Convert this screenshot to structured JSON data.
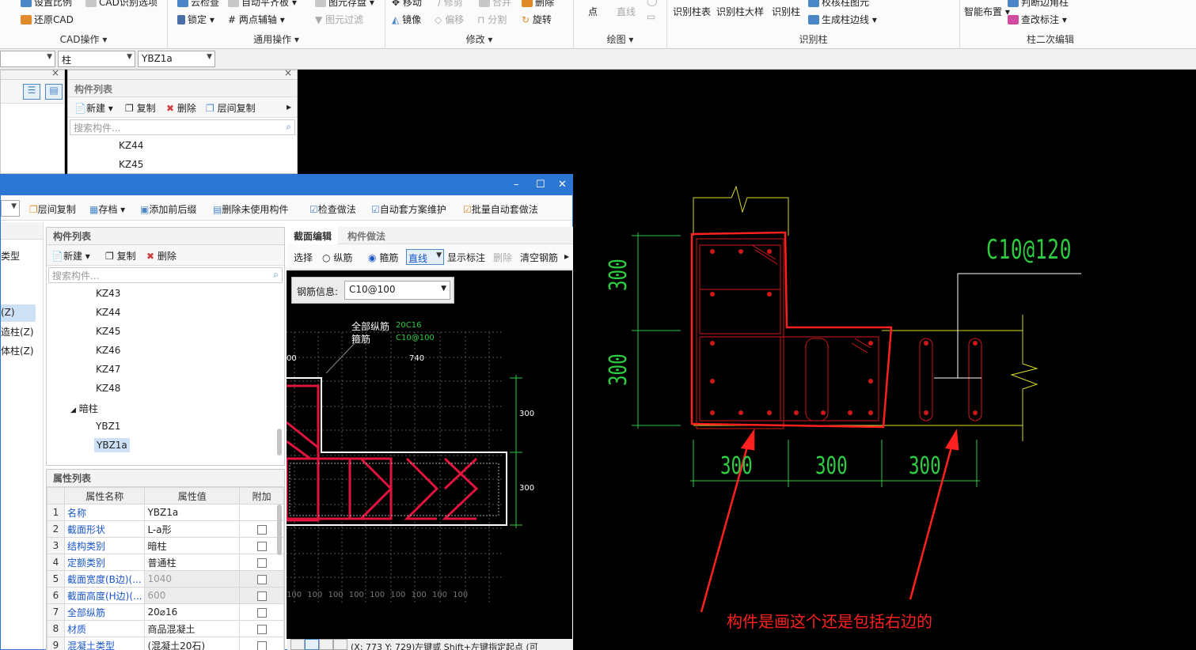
{
  "ribbon": {
    "cad_ops": {
      "items": [
        "设置比例",
        "CAD识别选项",
        "还原CAD"
      ],
      "title": "CAD操作"
    },
    "common_ops": {
      "items": [
        "云检查",
        "自动平齐板",
        "图元存盘",
        "锁定",
        "两点辅轴",
        "图元过滤"
      ],
      "title": "通用操作"
    },
    "modify": {
      "items": [
        "移动",
        "修剪",
        "合并",
        "删除",
        "镜像",
        "偏移",
        "分割",
        "旋转"
      ],
      "title": "修改"
    },
    "draw": {
      "items": [
        "点",
        "直线"
      ],
      "title": "绘图"
    },
    "recognize": {
      "items": [
        "识别柱表",
        "识别柱大样",
        "识别柱",
        "校核柱图元",
        "生成柱边线"
      ],
      "title": "识别柱"
    },
    "col_edit": {
      "items": [
        "智能布置",
        "判断边角柱",
        "查改标注"
      ],
      "title": "柱二次编辑"
    }
  },
  "selector": {
    "category": "柱",
    "component": "YBZ1a"
  },
  "back_panel": {
    "title": "构件列表",
    "new_label": "新建",
    "copy_label": "复制",
    "delete_label": "删除",
    "floor_copy_label": "层间复制",
    "search_placeholder": "搜索构件...",
    "items": [
      "KZ44",
      "KZ45"
    ]
  },
  "dialog": {
    "toolbar": [
      "层间复制",
      "存档",
      "添加前后缀",
      "删除未使用构件",
      "检查做法",
      "自动套方案维护",
      "批量自动套做法"
    ],
    "left_partial": [
      "类型",
      "(Z)",
      "造柱(Z)",
      "体柱(Z)"
    ],
    "list_title": "构件列表",
    "new_label": "新建",
    "copy_label": "复制",
    "delete_label": "删除",
    "search_placeholder": "搜索构件...",
    "tree": [
      "KZ43",
      "KZ44",
      "KZ45",
      "KZ46",
      "KZ47",
      "KZ48"
    ],
    "group_label": "暗柱",
    "group_items": [
      "YBZ1",
      "YBZ1a"
    ],
    "props_title": "属性列表",
    "props_headers": [
      "属性名称",
      "属性值",
      "附加"
    ],
    "props": [
      {
        "num": "1",
        "name": "名称",
        "value": "YBZ1a"
      },
      {
        "num": "2",
        "name": "截面形状",
        "value": "L-a形"
      },
      {
        "num": "3",
        "name": "结构类别",
        "value": "暗柱"
      },
      {
        "num": "4",
        "name": "定额类别",
        "value": "普通柱"
      },
      {
        "num": "5",
        "name": "截面宽度(B边)(...",
        "value": "1040"
      },
      {
        "num": "6",
        "name": "截面高度(H边)(...",
        "value": "600"
      },
      {
        "num": "7",
        "name": "全部纵筋",
        "value": "20⌀16"
      },
      {
        "num": "8",
        "name": "材质",
        "value": "商品混凝土"
      },
      {
        "num": "9",
        "name": "混凝土类型",
        "value": "(混凝土20石)"
      }
    ],
    "tabs": [
      "截面编辑",
      "构件做法"
    ],
    "edit_toolbar": {
      "select": "选择",
      "long_bar": "纵筋",
      "stirrup": "箍筋",
      "line_mode": "直线",
      "show_label": "显示标注",
      "delete": "删除",
      "clear": "清空钢筋"
    },
    "rebar_info_label": "钢筋信息:",
    "rebar_info_value": "C10@100",
    "canvas_labels": {
      "all_long": "全部纵筋",
      "stirrup": "箍筋",
      "spec1": "20C16",
      "spec2": "C10@100",
      "dim_740": "740",
      "dim_00": "00",
      "dim_300a": "300",
      "dim_300b": "300",
      "bottom_ticks": "100 100 100 100 100 100 100 100 100"
    },
    "status": "(X: 773 Y: 729)左键或 Shift+左键指定起点 (可"
  },
  "cad": {
    "stirrup_label": "C10@120",
    "dims": [
      "300",
      "300",
      "300",
      "300",
      "300"
    ],
    "annotation": "构件是画这个还是包括右边的"
  }
}
